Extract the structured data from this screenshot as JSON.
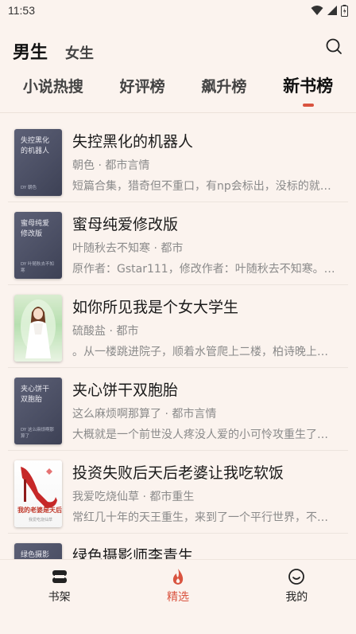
{
  "status_bar": {
    "time": "11:53"
  },
  "header": {
    "active_gender": "男生",
    "other_gender": "女生"
  },
  "rank_tabs": [
    {
      "label": "小说热搜",
      "active": false
    },
    {
      "label": "好评榜",
      "active": false
    },
    {
      "label": "飙升榜",
      "active": false
    },
    {
      "label": "新书榜",
      "active": true
    }
  ],
  "books": [
    {
      "title": "失控黑化的机器人",
      "meta": "朝色 · 都市言情",
      "desc": "短篇合集，猎奇但不重口，有np会标出，没标的就…",
      "cover": {
        "style": "plain",
        "title": "失控黑化的机器人",
        "author": "DY 朝色"
      }
    },
    {
      "title": "蜜母纯爱修改版",
      "meta": "叶随秋去不知寒 · 都市",
      "desc": "原作者：Gstar111，修改作者：叶随秋去不知寒。…",
      "cover": {
        "style": "plain",
        "title": "蜜母纯爱修改版",
        "author": "DY 叶随秋去不知寒"
      }
    },
    {
      "title": "如你所见我是个女大学生",
      "meta": "硫酸盐 · 都市",
      "desc": "。从一楼跳进院子，顺着水管爬上二楼，柏诗晚上…",
      "cover": {
        "style": "girl",
        "title": "",
        "author": ""
      }
    },
    {
      "title": "夹心饼干双胞胎",
      "meta": "这么麻烦啊那算了 · 都市言情",
      "desc": "大概就是一个前世没人疼没人爱的小可怜攻重生了…",
      "cover": {
        "style": "plain",
        "title": "夹心饼干双胞胎",
        "author": "DY 这么麻烦啊那算了"
      }
    },
    {
      "title": "投资失败后天后老婆让我吃软饭",
      "meta": "我爱吃烧仙草 · 都市重生",
      "desc": "常红几十年的天王重生，来到了一个平行世界，不…",
      "cover": {
        "style": "heel",
        "title": "我的老婆是天后",
        "author": "我爱吃烧仙草"
      }
    },
    {
      "title": "绿色摄影师李青生",
      "meta": "",
      "desc": "",
      "cover": {
        "style": "plain",
        "title": "绿色摄影师",
        "author": ""
      }
    }
  ],
  "bottom_nav": [
    {
      "label": "书架",
      "icon": "bookshelf-icon",
      "active": false
    },
    {
      "label": "精选",
      "icon": "flame-icon",
      "active": true
    },
    {
      "label": "我的",
      "icon": "smile-icon",
      "active": false
    }
  ],
  "colors": {
    "accent": "#d9533f",
    "background": "#fbf3ee"
  }
}
